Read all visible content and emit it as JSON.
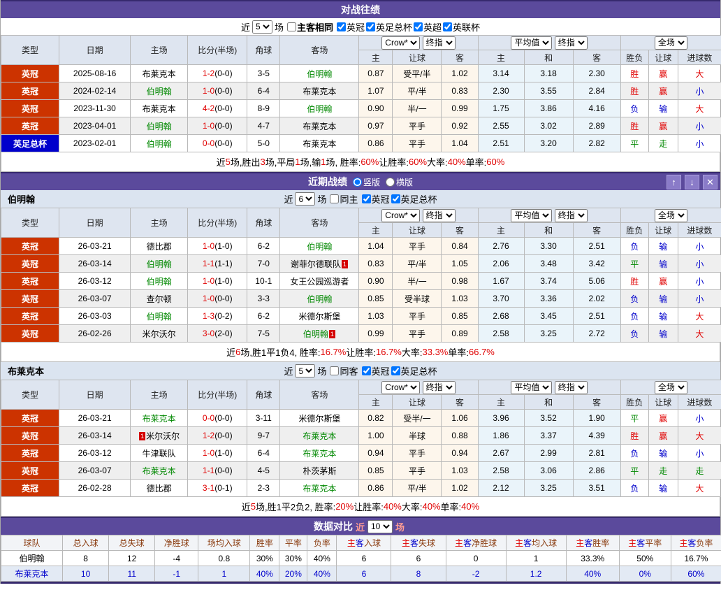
{
  "colors": {
    "accent_purple": "#5b4a9c",
    "league_red_badge": "#cc3300",
    "league_blue_badge": "#0000cc",
    "focus_team_green": "#008800",
    "win_red": "#e00000",
    "loss_blue": "#0000cc"
  },
  "icons": {
    "up": "↑",
    "down": "↓",
    "close": "✕"
  },
  "th": {
    "type": "类型",
    "date": "日期",
    "home": "主场",
    "score": "比分(半场)",
    "corner": "角球",
    "away": "客场",
    "h": "主",
    "handicap": "让球",
    "a": "客",
    "avg_h": "主",
    "avg_d": "和",
    "avg_a": "客",
    "result": "胜负",
    "h_result": "让球",
    "goals": "进球数",
    "provider": "Crow*",
    "final": "终指",
    "avg": "平均值",
    "scope": "全场"
  },
  "h2h": {
    "title": "对战往绩",
    "controls": {
      "near": "近",
      "count": "5",
      "unit": "场",
      "same": "主客相同",
      "leagues": [
        "英冠",
        "英足总杯",
        "英超",
        "英联杯"
      ]
    },
    "rows": [
      {
        "league": "英冠",
        "league_cls": "lg-red",
        "date": "2025-08-16",
        "home_pre": "",
        "home": "布莱克本",
        "home_post": "",
        "home_cls": "",
        "score": "1-2",
        "half": "(0-0)",
        "corner": "3-5",
        "away_pre": "",
        "away": "伯明翰",
        "away_post": "",
        "away_cls": "c-green",
        "o1": "0.87",
        "hcap": "受平/半",
        "o2": "1.02",
        "a1": "3.14",
        "a2": "3.18",
        "a3": "2.30",
        "r1": "胜",
        "r1c": "c-red",
        "r2": "赢",
        "r2c": "c-red",
        "r3": "大",
        "r3c": "c-red"
      },
      {
        "league": "英冠",
        "league_cls": "lg-red",
        "date": "2024-02-14",
        "home_pre": "",
        "home": "伯明翰",
        "home_post": "",
        "home_cls": "c-green",
        "score": "1-0",
        "half": "(0-0)",
        "corner": "6-4",
        "away_pre": "",
        "away": "布莱克本",
        "away_post": "",
        "away_cls": "",
        "o1": "1.07",
        "hcap": "平/半",
        "o2": "0.83",
        "a1": "2.30",
        "a2": "3.55",
        "a3": "2.84",
        "r1": "胜",
        "r1c": "c-red",
        "r2": "赢",
        "r2c": "c-red",
        "r3": "小",
        "r3c": "c-blue"
      },
      {
        "league": "英冠",
        "league_cls": "lg-red",
        "date": "2023-11-30",
        "home_pre": "",
        "home": "布莱克本",
        "home_post": "",
        "home_cls": "",
        "score": "4-2",
        "half": "(0-0)",
        "corner": "8-9",
        "away_pre": "",
        "away": "伯明翰",
        "away_post": "",
        "away_cls": "c-green",
        "o1": "0.90",
        "hcap": "半/一",
        "o2": "0.99",
        "a1": "1.75",
        "a2": "3.86",
        "a3": "4.16",
        "r1": "负",
        "r1c": "c-blue",
        "r2": "输",
        "r2c": "c-blue",
        "r3": "大",
        "r3c": "c-red"
      },
      {
        "league": "英冠",
        "league_cls": "lg-red",
        "date": "2023-04-01",
        "home_pre": "",
        "home": "伯明翰",
        "home_post": "",
        "home_cls": "c-green",
        "score": "1-0",
        "half": "(0-0)",
        "corner": "4-7",
        "away_pre": "",
        "away": "布莱克本",
        "away_post": "",
        "away_cls": "",
        "o1": "0.97",
        "hcap": "平手",
        "o2": "0.92",
        "a1": "2.55",
        "a2": "3.02",
        "a3": "2.89",
        "r1": "胜",
        "r1c": "c-red",
        "r2": "赢",
        "r2c": "c-red",
        "r3": "小",
        "r3c": "c-blue"
      },
      {
        "league": "英足总杯",
        "league_cls": "lg-blue",
        "date": "2023-02-01",
        "home_pre": "",
        "home": "伯明翰",
        "home_post": "",
        "home_cls": "c-green",
        "score": "0-0",
        "half": "(0-0)",
        "corner": "5-0",
        "away_pre": "",
        "away": "布莱克本",
        "away_post": "",
        "away_cls": "",
        "o1": "0.86",
        "hcap": "平手",
        "o2": "1.04",
        "a1": "2.51",
        "a2": "3.20",
        "a3": "2.82",
        "r1": "平",
        "r1c": "c-green",
        "r2": "走",
        "r2c": "c-green",
        "r3": "小",
        "r3c": "c-blue"
      }
    ],
    "summary": [
      {
        "t": "近 ",
        "c": ""
      },
      {
        "t": "5",
        "c": "c-red"
      },
      {
        "t": " 场,胜出 ",
        "c": ""
      },
      {
        "t": "3",
        "c": "c-red"
      },
      {
        "t": " 场,平局 ",
        "c": ""
      },
      {
        "t": "1",
        "c": "c-red"
      },
      {
        "t": " 场,输 ",
        "c": ""
      },
      {
        "t": "1",
        "c": "c-red"
      },
      {
        "t": " 场, 胜率: ",
        "c": ""
      },
      {
        "t": "60%",
        "c": "c-red"
      },
      {
        "t": " 让胜率: ",
        "c": ""
      },
      {
        "t": "60%",
        "c": "c-red"
      },
      {
        "t": " 大率: ",
        "c": ""
      },
      {
        "t": "40%",
        "c": "c-red"
      },
      {
        "t": " 单率: ",
        "c": ""
      },
      {
        "t": "60%",
        "c": "c-red"
      }
    ]
  },
  "recent": {
    "title": "近期战绩",
    "radio_vertical": "竖版",
    "radio_horizontal": "横版"
  },
  "birmingham": {
    "team": "伯明翰",
    "controls": {
      "near": "近",
      "count": "6",
      "unit": "场",
      "same": "同主",
      "leagues": [
        "英冠",
        "英足总杯"
      ]
    },
    "rows": [
      {
        "league": "英冠",
        "league_cls": "lg-red",
        "date": "26-03-21",
        "home_pre": "",
        "home": "德比郡",
        "home_post": "",
        "home_cls": "",
        "score": "1-0",
        "half": "(1-0)",
        "corner": "6-2",
        "away_pre": "",
        "away": "伯明翰",
        "away_post": "",
        "away_cls": "c-green",
        "o1": "1.04",
        "hcap": "平手",
        "o2": "0.84",
        "a1": "2.76",
        "a2": "3.30",
        "a3": "2.51",
        "r1": "负",
        "r1c": "c-blue",
        "r2": "输",
        "r2c": "c-blue",
        "r3": "小",
        "r3c": "c-blue"
      },
      {
        "league": "英冠",
        "league_cls": "lg-red",
        "date": "26-03-14",
        "home_pre": "",
        "home": "伯明翰",
        "home_post": "",
        "home_cls": "c-green",
        "score": "1-1",
        "half": "(1-1)",
        "corner": "7-0",
        "away_pre": "",
        "away": "谢菲尔德联队",
        "away_post": "1",
        "away_cls": "",
        "o1": "0.83",
        "hcap": "平/半",
        "o2": "1.05",
        "a1": "2.06",
        "a2": "3.48",
        "a3": "3.42",
        "r1": "平",
        "r1c": "c-green",
        "r2": "输",
        "r2c": "c-blue",
        "r3": "小",
        "r3c": "c-blue"
      },
      {
        "league": "英冠",
        "league_cls": "lg-red",
        "date": "26-03-12",
        "home_pre": "",
        "home": "伯明翰",
        "home_post": "",
        "home_cls": "c-green",
        "score": "1-0",
        "half": "(1-0)",
        "corner": "10-1",
        "away_pre": "",
        "away": "女王公园巡游者",
        "away_post": "",
        "away_cls": "",
        "o1": "0.90",
        "hcap": "半/一",
        "o2": "0.98",
        "a1": "1.67",
        "a2": "3.74",
        "a3": "5.06",
        "r1": "胜",
        "r1c": "c-red",
        "r2": "赢",
        "r2c": "c-red",
        "r3": "小",
        "r3c": "c-blue"
      },
      {
        "league": "英冠",
        "league_cls": "lg-red",
        "date": "26-03-07",
        "home_pre": "",
        "home": "查尔顿",
        "home_post": "",
        "home_cls": "",
        "score": "1-0",
        "half": "(0-0)",
        "corner": "3-3",
        "away_pre": "",
        "away": "伯明翰",
        "away_post": "",
        "away_cls": "c-green",
        "o1": "0.85",
        "hcap": "受半球",
        "o2": "1.03",
        "a1": "3.70",
        "a2": "3.36",
        "a3": "2.02",
        "r1": "负",
        "r1c": "c-blue",
        "r2": "输",
        "r2c": "c-blue",
        "r3": "小",
        "r3c": "c-blue"
      },
      {
        "league": "英冠",
        "league_cls": "lg-red",
        "date": "26-03-03",
        "home_pre": "",
        "home": "伯明翰",
        "home_post": "",
        "home_cls": "c-green",
        "score": "1-3",
        "half": "(0-2)",
        "corner": "6-2",
        "away_pre": "",
        "away": "米德尔斯堡",
        "away_post": "",
        "away_cls": "",
        "o1": "1.03",
        "hcap": "平手",
        "o2": "0.85",
        "a1": "2.68",
        "a2": "3.45",
        "a3": "2.51",
        "r1": "负",
        "r1c": "c-blue",
        "r2": "输",
        "r2c": "c-blue",
        "r3": "大",
        "r3c": "c-red"
      },
      {
        "league": "英冠",
        "league_cls": "lg-red",
        "date": "26-02-26",
        "home_pre": "",
        "home": "米尔沃尔",
        "home_post": "",
        "home_cls": "",
        "score": "3-0",
        "half": "(2-0)",
        "corner": "7-5",
        "away_pre": "",
        "away": "伯明翰",
        "away_post": "1",
        "away_cls": "c-green",
        "o1": "0.99",
        "hcap": "平手",
        "o2": "0.89",
        "a1": "2.58",
        "a2": "3.25",
        "a3": "2.72",
        "r1": "负",
        "r1c": "c-blue",
        "r2": "输",
        "r2c": "c-blue",
        "r3": "大",
        "r3c": "c-red"
      }
    ],
    "summary": [
      {
        "t": "近",
        "c": ""
      },
      {
        "t": "6",
        "c": "c-red"
      },
      {
        "t": "场,胜1平1负4, 胜率:",
        "c": ""
      },
      {
        "t": "16.7%",
        "c": "c-red"
      },
      {
        "t": " 让胜率:",
        "c": ""
      },
      {
        "t": "16.7%",
        "c": "c-red"
      },
      {
        "t": " 大率:",
        "c": ""
      },
      {
        "t": "33.3%",
        "c": "c-red"
      },
      {
        "t": " 单率:",
        "c": ""
      },
      {
        "t": "66.7%",
        "c": "c-red"
      }
    ]
  },
  "blackburn": {
    "team": "布莱克本",
    "controls": {
      "near": "近",
      "count": "5",
      "unit": "场",
      "same": "同客",
      "leagues": [
        "英冠",
        "英足总杯"
      ]
    },
    "rows": [
      {
        "league": "英冠",
        "league_cls": "lg-red",
        "date": "26-03-21",
        "home_pre": "",
        "home": "布莱克本",
        "home_post": "",
        "home_cls": "c-green",
        "score": "0-0",
        "half": "(0-0)",
        "corner": "3-11",
        "away_pre": "",
        "away": "米德尔斯堡",
        "away_post": "",
        "away_cls": "",
        "o1": "0.82",
        "hcap": "受半/一",
        "o2": "1.06",
        "a1": "3.96",
        "a2": "3.52",
        "a3": "1.90",
        "r1": "平",
        "r1c": "c-green",
        "r2": "赢",
        "r2c": "c-red",
        "r3": "小",
        "r3c": "c-blue"
      },
      {
        "league": "英冠",
        "league_cls": "lg-red",
        "date": "26-03-14",
        "home_pre": "1",
        "home": "米尔沃尔",
        "home_post": "",
        "home_cls": "",
        "score": "1-2",
        "half": "(0-0)",
        "corner": "9-7",
        "away_pre": "",
        "away": "布莱克本",
        "away_post": "",
        "away_cls": "c-green",
        "o1": "1.00",
        "hcap": "半球",
        "o2": "0.88",
        "a1": "1.86",
        "a2": "3.37",
        "a3": "4.39",
        "r1": "胜",
        "r1c": "c-red",
        "r2": "赢",
        "r2c": "c-red",
        "r3": "大",
        "r3c": "c-red"
      },
      {
        "league": "英冠",
        "league_cls": "lg-red",
        "date": "26-03-12",
        "home_pre": "",
        "home": "牛津联队",
        "home_post": "",
        "home_cls": "",
        "score": "1-0",
        "half": "(1-0)",
        "corner": "6-4",
        "away_pre": "",
        "away": "布莱克本",
        "away_post": "",
        "away_cls": "c-green",
        "o1": "0.94",
        "hcap": "平手",
        "o2": "0.94",
        "a1": "2.67",
        "a2": "2.99",
        "a3": "2.81",
        "r1": "负",
        "r1c": "c-blue",
        "r2": "输",
        "r2c": "c-blue",
        "r3": "小",
        "r3c": "c-blue"
      },
      {
        "league": "英冠",
        "league_cls": "lg-red",
        "date": "26-03-07",
        "home_pre": "",
        "home": "布莱克本",
        "home_post": "",
        "home_cls": "c-green",
        "score": "1-1",
        "half": "(0-0)",
        "corner": "4-5",
        "away_pre": "",
        "away": "朴茨茅斯",
        "away_post": "",
        "away_cls": "",
        "o1": "0.85",
        "hcap": "平手",
        "o2": "1.03",
        "a1": "2.58",
        "a2": "3.06",
        "a3": "2.86",
        "r1": "平",
        "r1c": "c-green",
        "r2": "走",
        "r2c": "c-green",
        "r3": "走",
        "r3c": "c-green"
      },
      {
        "league": "英冠",
        "league_cls": "lg-red",
        "date": "26-02-28",
        "home_pre": "",
        "home": "德比郡",
        "home_post": "",
        "home_cls": "",
        "score": "3-1",
        "half": "(0-1)",
        "corner": "2-3",
        "away_pre": "",
        "away": "布莱克本",
        "away_post": "",
        "away_cls": "c-green",
        "o1": "0.86",
        "hcap": "平/半",
        "o2": "1.02",
        "a1": "2.12",
        "a2": "3.25",
        "a3": "3.51",
        "r1": "负",
        "r1c": "c-blue",
        "r2": "输",
        "r2c": "c-blue",
        "r3": "大",
        "r3c": "c-red"
      }
    ],
    "summary": [
      {
        "t": "近",
        "c": ""
      },
      {
        "t": "5",
        "c": "c-red"
      },
      {
        "t": "场,胜1平2负2, 胜率:",
        "c": ""
      },
      {
        "t": "20%",
        "c": "c-red"
      },
      {
        "t": " 让胜率:",
        "c": ""
      },
      {
        "t": "40%",
        "c": "c-red"
      },
      {
        "t": " 大率:",
        "c": ""
      },
      {
        "t": "40%",
        "c": "c-red"
      },
      {
        "t": " 单率:",
        "c": ""
      },
      {
        "t": "40%",
        "c": "c-red"
      }
    ]
  },
  "compare": {
    "title": "数据对比",
    "near": "近",
    "count": "10",
    "unit": "场",
    "home_char": "主",
    "away_char": "客",
    "simple_headers": [
      "球队",
      "总入球",
      "总失球",
      "净胜球",
      "场均入球",
      "胜率",
      "平率",
      "负率"
    ],
    "composite_suffixes": [
      "入球",
      "失球",
      "净胜球",
      "均入球",
      "胜率",
      "平率",
      "负率"
    ],
    "rows": [
      {
        "cls": "",
        "cells": [
          "伯明翰",
          "8",
          "12",
          "-4",
          "0.8",
          "30%",
          "30%",
          "40%",
          "6",
          "6",
          "0",
          "1",
          "33.3%",
          "50%",
          "16.7%"
        ]
      },
      {
        "cls": "row-blue",
        "cells": [
          "布莱克本",
          "10",
          "11",
          "-1",
          "1",
          "40%",
          "20%",
          "40%",
          "6",
          "8",
          "-2",
          "1.2",
          "40%",
          "0%",
          "60%"
        ]
      }
    ]
  }
}
